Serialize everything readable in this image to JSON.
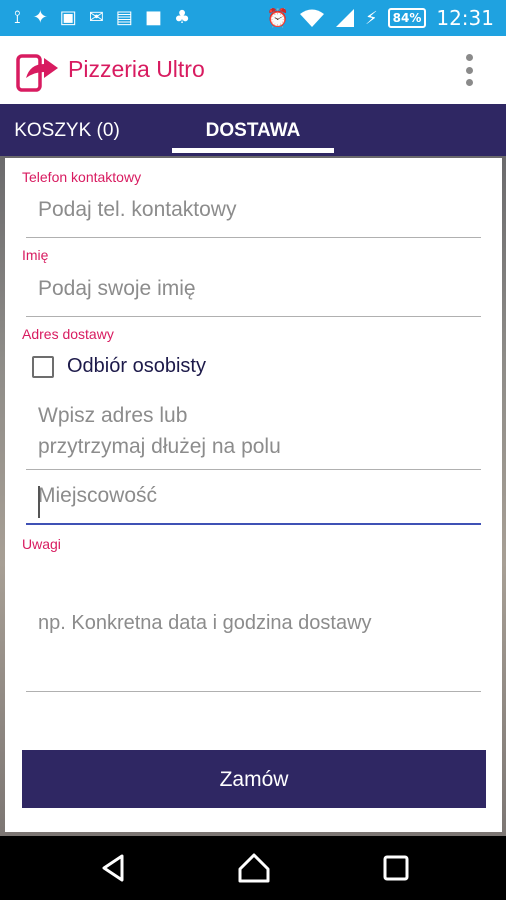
{
  "status_bar": {
    "icons_left": [
      "usb-icon",
      "twitter-icon",
      "image-icon",
      "mail-icon",
      "clipboard-icon",
      "briefcase-icon",
      "android-icon"
    ],
    "icons_right": [
      "alarm-icon",
      "wifi-icon",
      "signal-icon",
      "charging-icon"
    ],
    "battery": "84%",
    "time": "12:31"
  },
  "app": {
    "title": "Pizzeria Ultro",
    "brand_color": "#d81b60",
    "primary_color": "#2f2763"
  },
  "tabs": [
    {
      "label": "KOSZYK (0)",
      "selected": false
    },
    {
      "label": "DOSTAWA",
      "selected": true
    }
  ],
  "form": {
    "phone": {
      "label": "Telefon kontaktowy",
      "placeholder": "Podaj tel. kontaktowy",
      "value": ""
    },
    "name": {
      "label": "Imię",
      "placeholder": "Podaj swoje imię",
      "value": ""
    },
    "address_section": {
      "label": "Adres dostawy",
      "pickup_checkbox": {
        "label": "Odbiór osobisty",
        "checked": false
      },
      "address": {
        "placeholder_line1": "Wpisz adres lub",
        "placeholder_line2": "przytrzymaj dłużej na polu",
        "value": ""
      },
      "city": {
        "placeholder": "Miejscowość",
        "value": "",
        "focused": true
      }
    },
    "notes": {
      "label": "Uwagi",
      "placeholder": "np. Konkretna data i godzina dostawy",
      "value": ""
    },
    "submit_label": "Zamów"
  },
  "nav_bar": [
    "back-icon",
    "home-icon",
    "recents-icon"
  ]
}
